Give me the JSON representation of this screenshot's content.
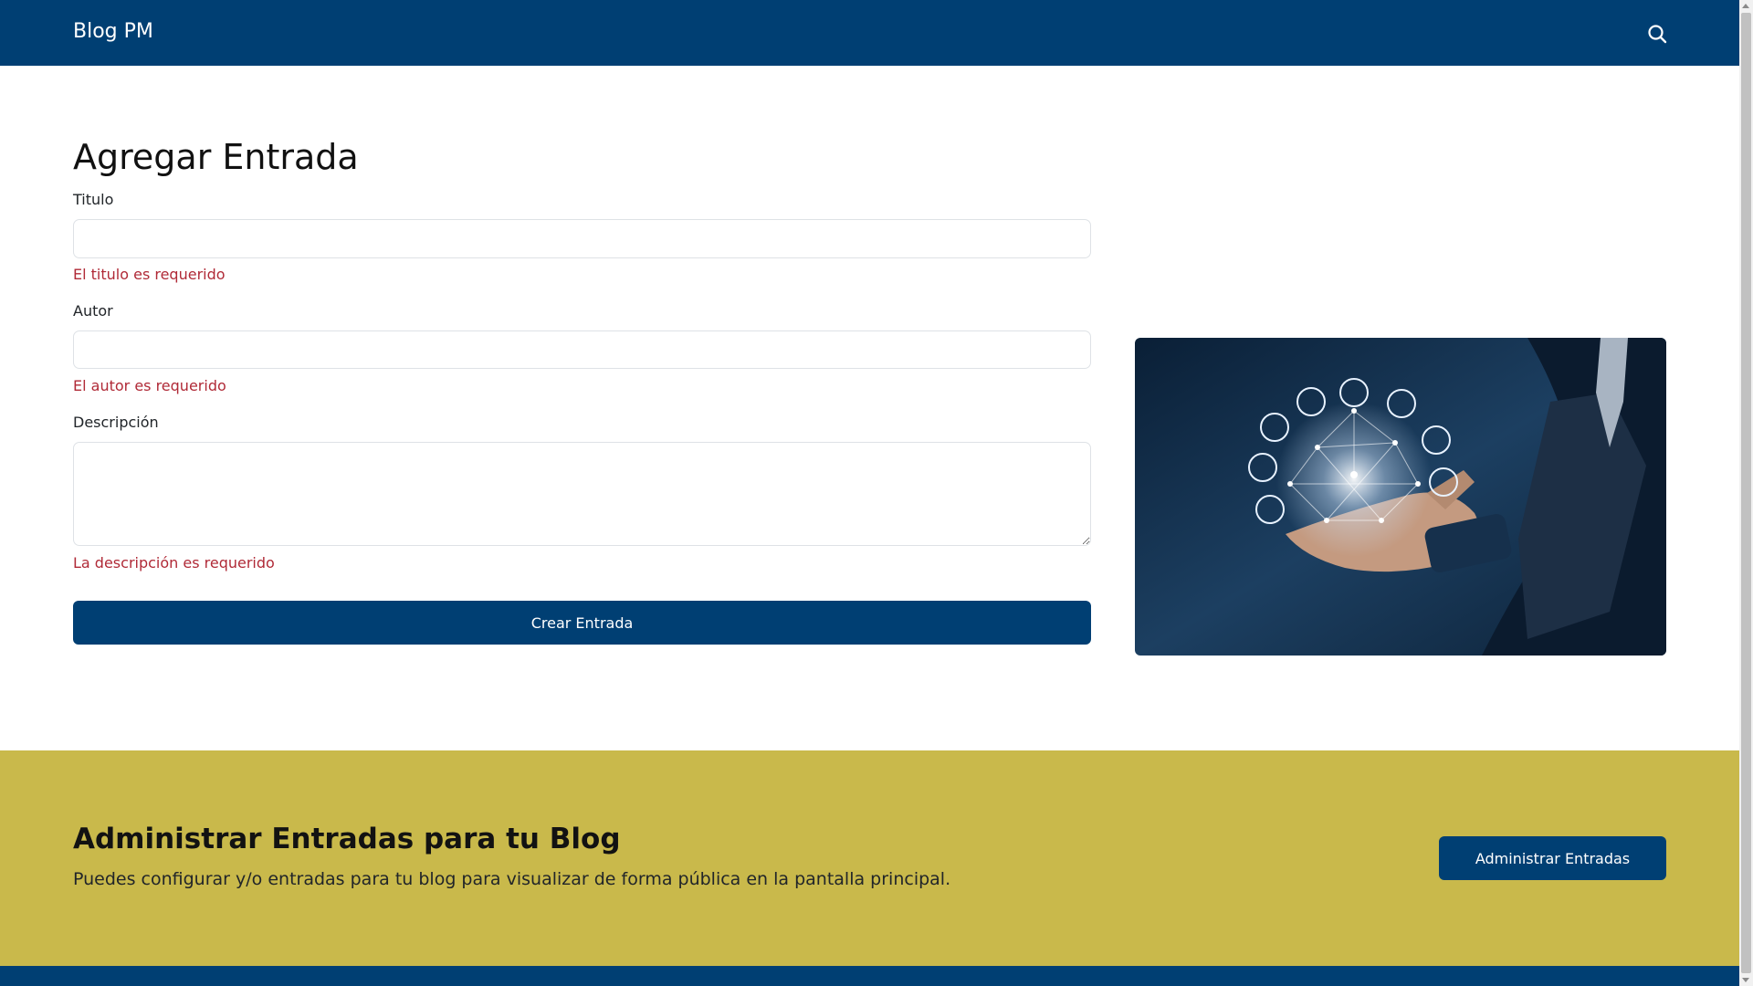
{
  "navbar": {
    "brand": "Blog PM",
    "search_icon": "search-icon"
  },
  "form": {
    "heading": "Agregar Entrada",
    "fields": [
      {
        "label": "Titulo",
        "value": "",
        "error": "El titulo es requerido"
      },
      {
        "label": "Autor",
        "value": "",
        "error": "El autor es requerido"
      },
      {
        "label": "Descripción",
        "value": "",
        "error": "La descripción es requerido"
      }
    ],
    "submit_label": "Crear Entrada"
  },
  "banner": {
    "title": "Administrar Entradas para tu Blog",
    "text": "Puedes configurar y/o entradas para tu blog para visualizar de forma pública en la pantalla principal.",
    "button_label": "Administrar Entradas"
  },
  "colors": {
    "primary": "#003f73",
    "banner": "#c9b94b",
    "error": "#b02a37"
  }
}
